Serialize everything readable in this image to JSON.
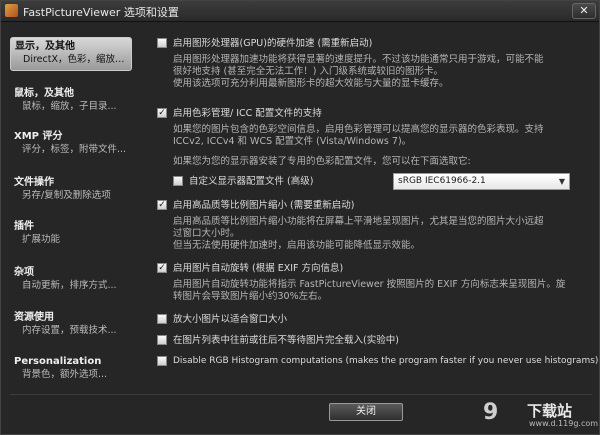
{
  "window": {
    "title": "FastPictureViewer 选项和设置",
    "close_glyph": "✕"
  },
  "sidebar": {
    "items": [
      {
        "title": "显示，及其他",
        "sub": "DirectX，色彩，缩放，..."
      },
      {
        "title": "鼠标，及其他",
        "sub": "鼠标，缩放，子目录..."
      },
      {
        "title": "XMP 评分",
        "sub": "评分，标签，附带文件..."
      },
      {
        "title": "文件操作",
        "sub": "另存/复制及删除选项"
      },
      {
        "title": "插件",
        "sub": "扩展功能"
      },
      {
        "title": "杂项",
        "sub": "自动更新，排序方式..."
      },
      {
        "title": "资源使用",
        "sub": "内存设置，预载技术..."
      },
      {
        "title": "Personalization",
        "sub": "背景色，额外选项..."
      }
    ]
  },
  "options": {
    "gpu": {
      "label": "启用图形处理器(GPU)的硬件加速 (需重新启动)",
      "checked": false,
      "desc": [
        "启用图形处理器加速功能将获得显著的速度提升。不过该功能通常只用于游戏，可能不能",
        "很好地支持 (甚至完全无法工作！) 入门级系统或较旧的图形卡。",
        "使用该选项可充分利用最新图形卡的超大效能与大量的显卡缓存。"
      ]
    },
    "color": {
      "label": "启用色彩管理/ ICC 配置文件的支持",
      "checked": true,
      "desc": [
        "如果您的图片包含的色彩空间信息，启用色彩管理可以提高您的显示器的色彩表现。支持",
        "ICCv2, ICCv4 和 WCS 配置文件 (Vista/Windows 7)。"
      ],
      "profile_hint": "如果您为您的显示器安装了专用的色彩配置文件，您可以在下面选取它:",
      "custom_label": "自定义显示器配置文件 (高级)",
      "custom_checked": false,
      "profile_value": "sRGB IEC61966-2.1",
      "arrow_glyph": "▼"
    },
    "thumb": {
      "label": "启用高品质等比例图片缩小 (需要重新启动)",
      "checked": true,
      "desc": [
        "启用高品质等比例图片缩小功能将在屏幕上平滑地呈现图片，尤其是当您的图片大小远超",
        "过窗口大小时。",
        "但当无法使用硬件加速时，启用该功能可能降低显示效能。"
      ]
    },
    "rotate": {
      "label": "启用图片自动旋转 (根据 EXIF 方向信息)",
      "checked": true,
      "desc": [
        "启用图片自动旋转功能将指示 FastPictureViewer 按照图片的 EXIF 方向标志来呈现图片。旋",
        "转图片会导致图片缩小约30%左右。"
      ]
    },
    "enlarge": {
      "label": "放大小图片以适合窗口大小",
      "checked": false
    },
    "fullload": {
      "label": "在图片列表中往前或往后不等待图片完全载入(实验中)",
      "checked": false
    },
    "histogram": {
      "label": "Disable RGB Histogram computations (makes the program faster if you never use histograms)",
      "checked": false
    }
  },
  "footer": {
    "close_label": "关闭"
  },
  "watermark": {
    "logo": "9",
    "text": "下载站",
    "url": "www.d.119g.com"
  },
  "colors": {
    "background": "#262626",
    "active_nav": "#c8c8c8",
    "text": "#dddddd"
  }
}
